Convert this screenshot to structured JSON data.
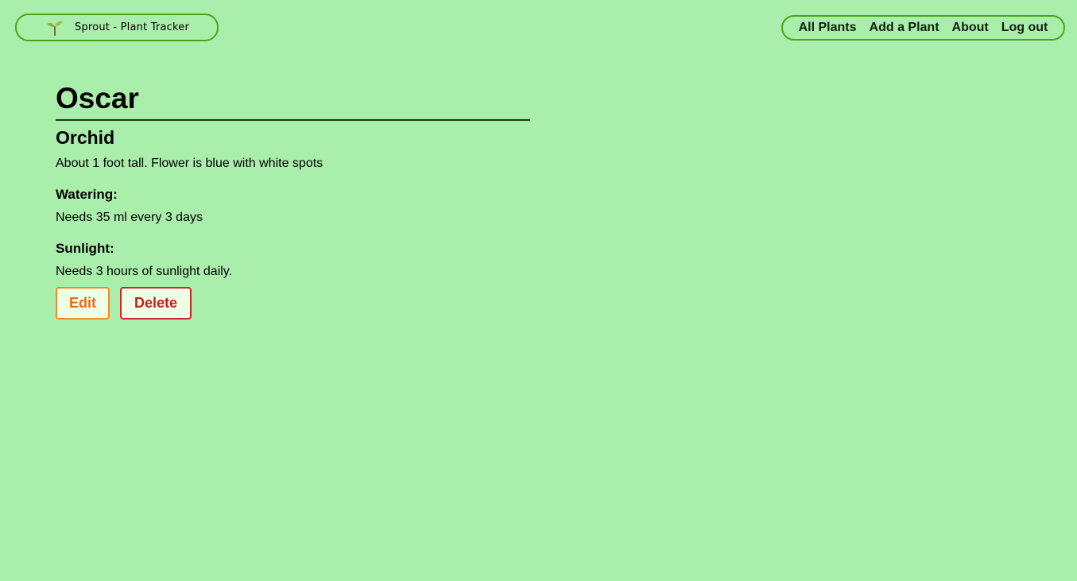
{
  "brand": {
    "icon": "sprout-icon",
    "title": "Sprout - Plant Tracker"
  },
  "nav": {
    "items": [
      {
        "label": "All Plants"
      },
      {
        "label": "Add a Plant"
      },
      {
        "label": "About"
      },
      {
        "label": "Log out"
      }
    ]
  },
  "plant": {
    "name": "Oscar",
    "species": "Orchid",
    "description": "About 1 foot tall. Flower is blue with white spots",
    "watering": {
      "label": "Watering:",
      "text": "Needs 35 ml every 3 days"
    },
    "sunlight": {
      "label": "Sunlight:",
      "text": "Needs 3 hours of sunlight daily."
    }
  },
  "actions": {
    "edit_label": "Edit",
    "delete_label": "Delete"
  },
  "colors": {
    "background": "#aaeeab",
    "border_green": "#4aa51b",
    "edit_orange": "#ea6c12",
    "delete_red": "#c8201f"
  }
}
